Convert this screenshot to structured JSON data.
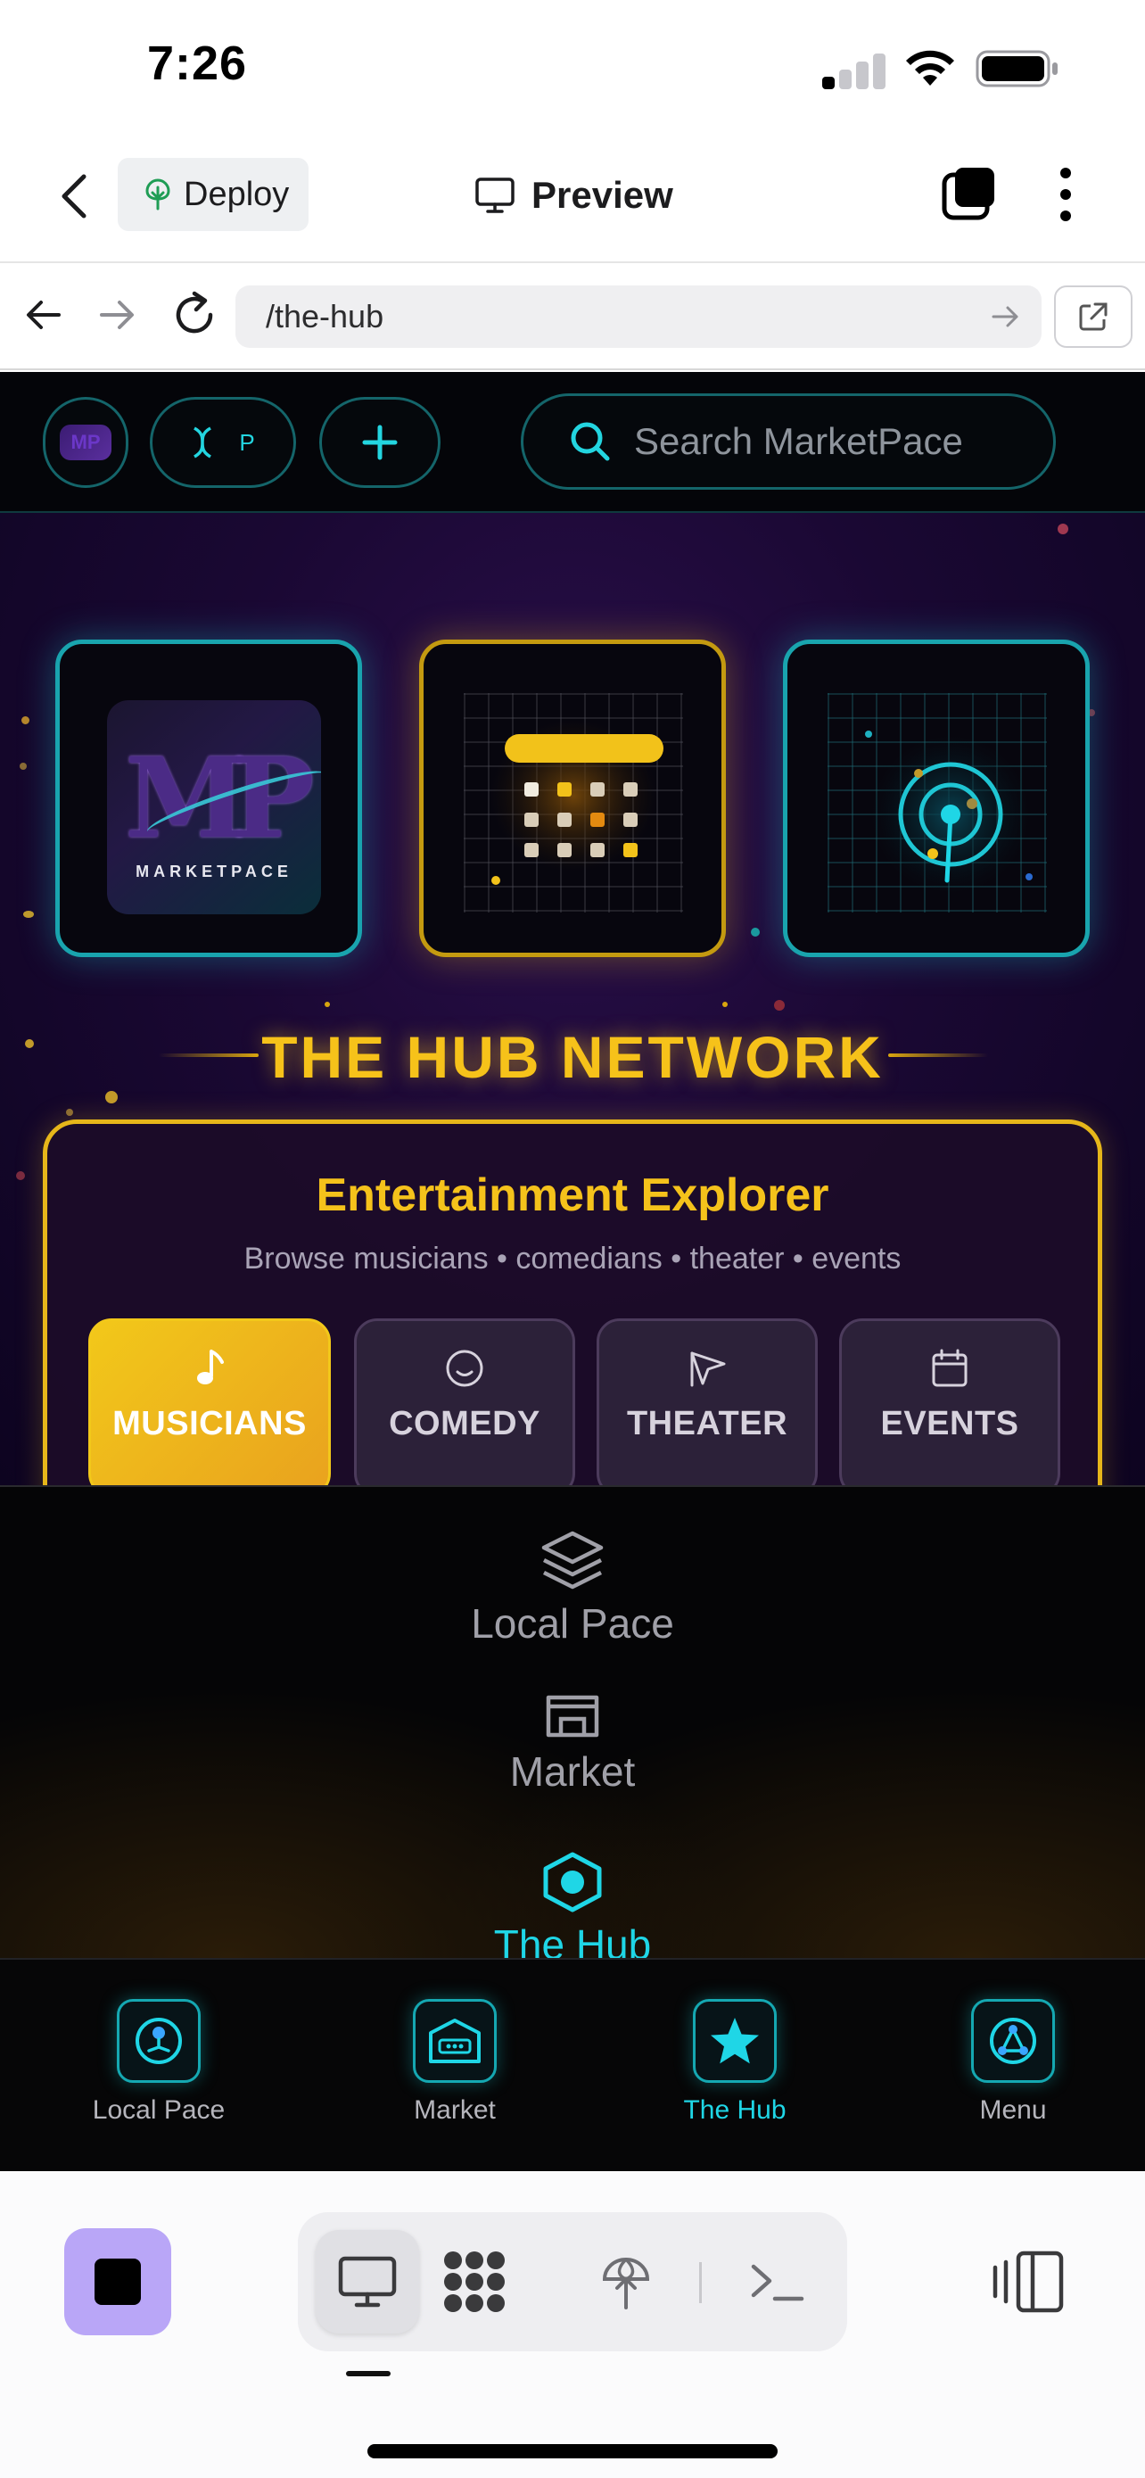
{
  "status_bar": {
    "time": "7:26"
  },
  "app_bar": {
    "deploy_label": "Deploy",
    "title": "Preview"
  },
  "url_bar": {
    "url": "/the-hub"
  },
  "site": {
    "search_placeholder": "Search MarketPace",
    "header_pill_letter": "P",
    "header_logo_text": "MP",
    "logo_letters": "MP",
    "logo_word": "MARKETPACE",
    "hub_title": "THE HUB NETWORK",
    "explorer": {
      "title": "Entertainment Explorer",
      "subtitle": "Browse musicians • comedians • theater • events",
      "tabs": [
        {
          "label": "MUSICIANS",
          "icon": "music-note-icon",
          "active": true
        },
        {
          "label": "COMEDY",
          "icon": "smiley-icon",
          "active": false
        },
        {
          "label": "THEATER",
          "icon": "theater-icon",
          "active": false
        },
        {
          "label": "EVENTS",
          "icon": "calendar-icon",
          "active": false
        }
      ]
    },
    "drawer": [
      {
        "label": "Local Pace",
        "icon": "layers-icon"
      },
      {
        "label": "Market",
        "icon": "market-icon"
      },
      {
        "label": "The Hub",
        "icon": "hub-hexagon-icon",
        "active": true
      }
    ],
    "bottom_nav": [
      {
        "label": "Local Pace",
        "icon": "local-pace-icon"
      },
      {
        "label": "Market",
        "icon": "market-icon"
      },
      {
        "label": "The Hub",
        "icon": "star-icon",
        "active": true
      },
      {
        "label": "Menu",
        "icon": "menu-icon"
      }
    ]
  },
  "colors": {
    "accent_gold": "#f5c21b",
    "accent_cyan": "#1fd6e6",
    "stop_button": "#b9a6f7"
  }
}
